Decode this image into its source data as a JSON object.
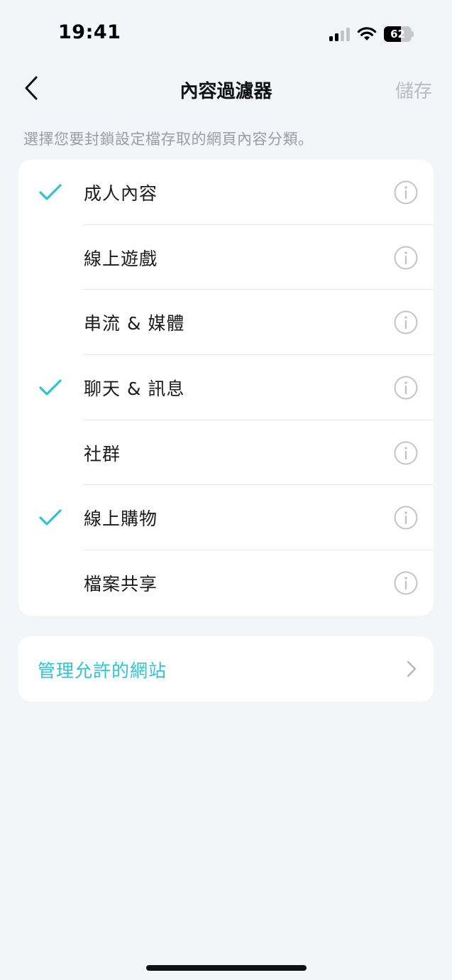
{
  "status_bar": {
    "time": "19:41",
    "battery_level": "62"
  },
  "nav": {
    "title": "內容過濾器",
    "save_label": "儲存"
  },
  "description": "選擇您要封鎖設定檔存取的網頁內容分類。",
  "categories": [
    {
      "label": "成人內容",
      "checked": true
    },
    {
      "label": "線上遊戲",
      "checked": false
    },
    {
      "label": "串流 & 媒體",
      "checked": false
    },
    {
      "label": "聊天 & 訊息",
      "checked": true
    },
    {
      "label": "社群",
      "checked": false
    },
    {
      "label": "線上購物",
      "checked": true
    },
    {
      "label": "檔案共享",
      "checked": false
    }
  ],
  "allowed_sites": {
    "label": "管理允許的網站"
  },
  "colors": {
    "accent": "#2ec4d6",
    "background": "#f4f5f9",
    "muted": "#b9bcc3"
  },
  "icons": {
    "check": "check-icon",
    "info": "info-icon",
    "back": "chevron-left-icon",
    "forward": "chevron-right-icon"
  }
}
